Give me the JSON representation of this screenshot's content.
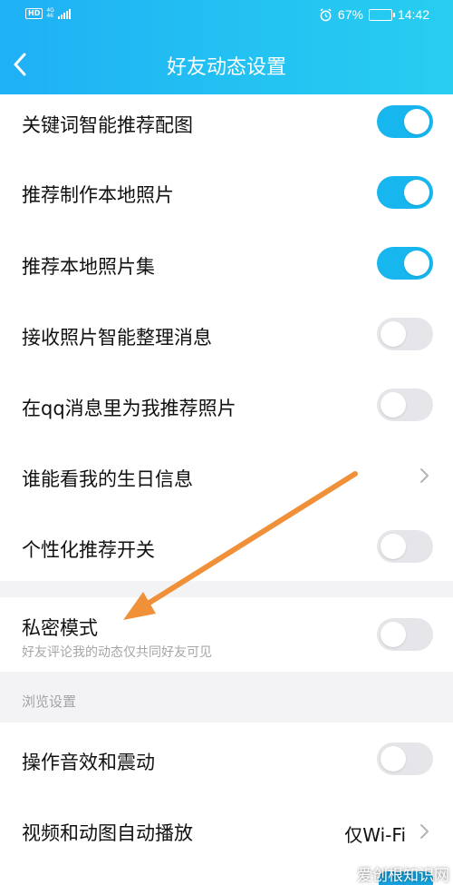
{
  "status_bar": {
    "hd": "HD",
    "network_top": "4G",
    "network_bottom": "46",
    "battery_percent": "67%",
    "battery_level": 0.67,
    "time": "14:42"
  },
  "header": {
    "title": "好友动态设置",
    "back_icon": "chevron-left-icon"
  },
  "settings": [
    {
      "label": "关键词智能推荐配图",
      "type": "toggle",
      "on": true
    },
    {
      "label": "推荐制作本地照片",
      "type": "toggle",
      "on": true
    },
    {
      "label": "推荐本地照片集",
      "type": "toggle",
      "on": true
    },
    {
      "label": "接收照片智能整理消息",
      "type": "toggle",
      "on": false
    },
    {
      "label": "在qq消息里为我推荐照片",
      "type": "toggle",
      "on": false
    },
    {
      "label": "谁能看我的生日信息",
      "type": "link"
    },
    {
      "label": "个性化推荐开关",
      "type": "toggle",
      "on": false
    }
  ],
  "private_mode": {
    "label": "私密模式",
    "description": "好友评论我的动态仅共同好友可见",
    "on": false
  },
  "browse_section": {
    "title": "浏览设置",
    "items": [
      {
        "label": "操作音效和震动",
        "type": "toggle",
        "on": false
      },
      {
        "label": "视频和动图自动播放",
        "type": "select",
        "value": "仅Wi-Fi"
      }
    ]
  },
  "watermark": "爱创根知识网",
  "colors": {
    "header_start": "#1fb0f5",
    "header_end": "#28cdf0",
    "toggle_on": "#17b6ee",
    "toggle_off": "#e6e6ea",
    "annotation_arrow": "#f0913a"
  }
}
